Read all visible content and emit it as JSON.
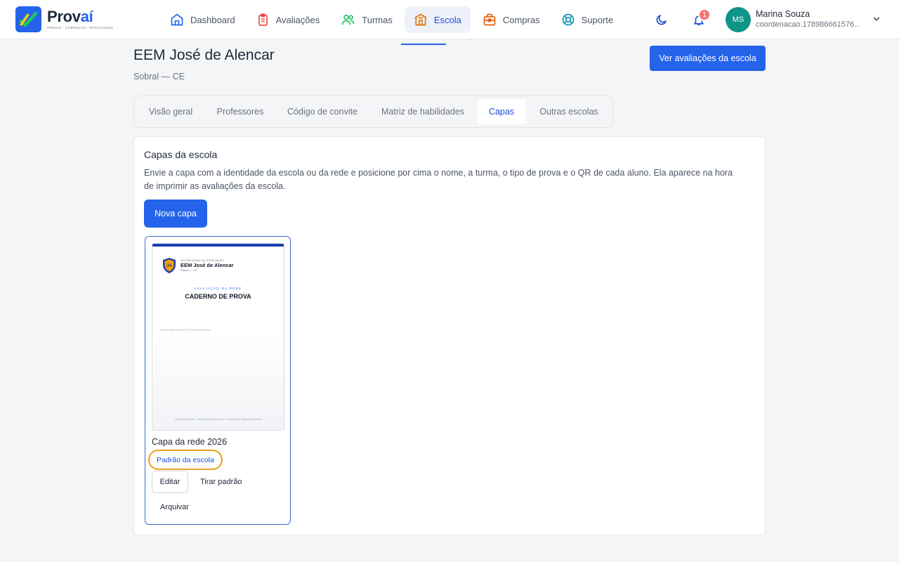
{
  "brand": {
    "name_main": "Prov",
    "name_accent": "aí",
    "tagline": "PROVAS · CORREÇÃO · RESULTADOS"
  },
  "nav": {
    "items": [
      {
        "label": "Dashboard",
        "icon": "home-icon"
      },
      {
        "label": "Avaliações",
        "icon": "clipboard-icon"
      },
      {
        "label": "Turmas",
        "icon": "users-icon"
      },
      {
        "label": "Escola",
        "icon": "school-icon"
      },
      {
        "label": "Compras",
        "icon": "shopping-bag-icon"
      },
      {
        "label": "Suporte",
        "icon": "lifebuoy-icon"
      }
    ],
    "active": "Escola"
  },
  "header_actions": {
    "theme_icon": "moon-icon",
    "notifications_icon": "bell-icon",
    "notification_count": "1"
  },
  "user": {
    "initials": "MS",
    "name": "Marina Souza",
    "email": "coordenacao.178986661576...",
    "avatar_color": "#0f9488"
  },
  "page": {
    "title": "EEM José de Alencar",
    "subtitle": "Sobral — CE",
    "primary_action": "Ver avaliações da escola"
  },
  "tabs": [
    {
      "label": "Visão geral"
    },
    {
      "label": "Professores"
    },
    {
      "label": "Código de convite"
    },
    {
      "label": "Matriz de habilidades"
    },
    {
      "label": "Capas"
    },
    {
      "label": "Outras escolas"
    }
  ],
  "active_tab": "Capas",
  "covers": {
    "title": "Capas da escola",
    "description": "Envie a capa com a identidade da escola ou da rede e posicione por cima o nome, a turma, o tipo de prova e o QR de cada aluno. Ela aparece na hora de imprimir as avaliações da escola.",
    "new_button": "Nova capa",
    "items": [
      {
        "name": "Capa da rede 2026",
        "badge": "Padrão da escola",
        "actions": {
          "edit": "Editar",
          "unset_default": "Tirar padrão",
          "archive": "Arquivar"
        },
        "preview": {
          "shield_initials": "JA",
          "secretariat": "SECRETARIA DA EDUCAÇÃO",
          "school": "EEM José de Alencar",
          "city": "Sobral — CE",
          "kicker": "AVALIAÇÃO DA REDE",
          "title": "CADERNO DE PROVA",
          "field_label": "ESTA AVALIAÇÃO ESTÁ RESERVADA",
          "footer": "Leia com atenção · Use caneta preta ou azul · Preencha o Gabarito completo"
        }
      }
    ]
  },
  "colors": {
    "primary": "#2563eb",
    "badge_ring": "#e8a21c",
    "notification": "#f87171",
    "shield": "#1e40af",
    "shield_fill": "#f59e0b"
  }
}
